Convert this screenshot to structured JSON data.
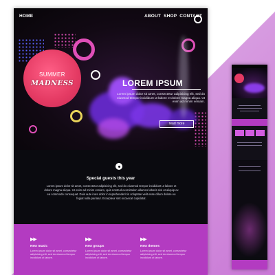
{
  "nav": {
    "home": "HOME",
    "links": [
      "ABOUT",
      "SHOP",
      "CONTACT"
    ]
  },
  "hero": {
    "badge_line1": "SUMMER",
    "badge_line2": "MADNESS",
    "title": "LOREM IPSUM",
    "text": "Lorem ipsum dolor sit amet, consectetur adipisicing elit, sed do eiusmod tempor incididunt ut labore et dolore magna aliqua. Ut enim ad minim veniam.",
    "button": "read more"
  },
  "guests": {
    "title": "Special guests this year",
    "text": "Lorem ipsum dolor sit amet, consectetur adipisicing elit, sed do eiusmod tempor incididunt ut labore et dolore magna aliqua. Ut enim ad minim veniam, quis nostrud exercitation ullamco laboris nisi ut aliquip ex ea commodo consequat. Duis aute irure dolor in reprehenderit in voluptate velit esse cillum dolore eu fugiat nulla pariatur. Excepteur sint occaecat cupidatat."
  },
  "services": [
    {
      "icon": "fast-forward-icon",
      "glyph": "▶▶",
      "title": "New music",
      "text": "Lorem ipsum dolor sit amet, consectetur adipisicing elit, sed do eiusmod tempor incididunt ut labore."
    },
    {
      "icon": "fast-forward-icon",
      "glyph": "▶▶",
      "title": "New groups",
      "text": "Lorem ipsum dolor sit amet, consectetur adipisicing elit, sed do eiusmod tempor incididunt ut labore."
    },
    {
      "icon": "fast-forward-icon",
      "glyph": "▶▶",
      "title": "New themes",
      "text": "Lorem ipsum dolor sit amet, consectetur adipisicing elit, sed do eiusmod tempor incididunt ut labore."
    }
  ],
  "colors": {
    "accent": "#b33bc1",
    "pink": "#e43a63",
    "smoke": "#8a3ce8",
    "background": "#0a0a0f"
  }
}
